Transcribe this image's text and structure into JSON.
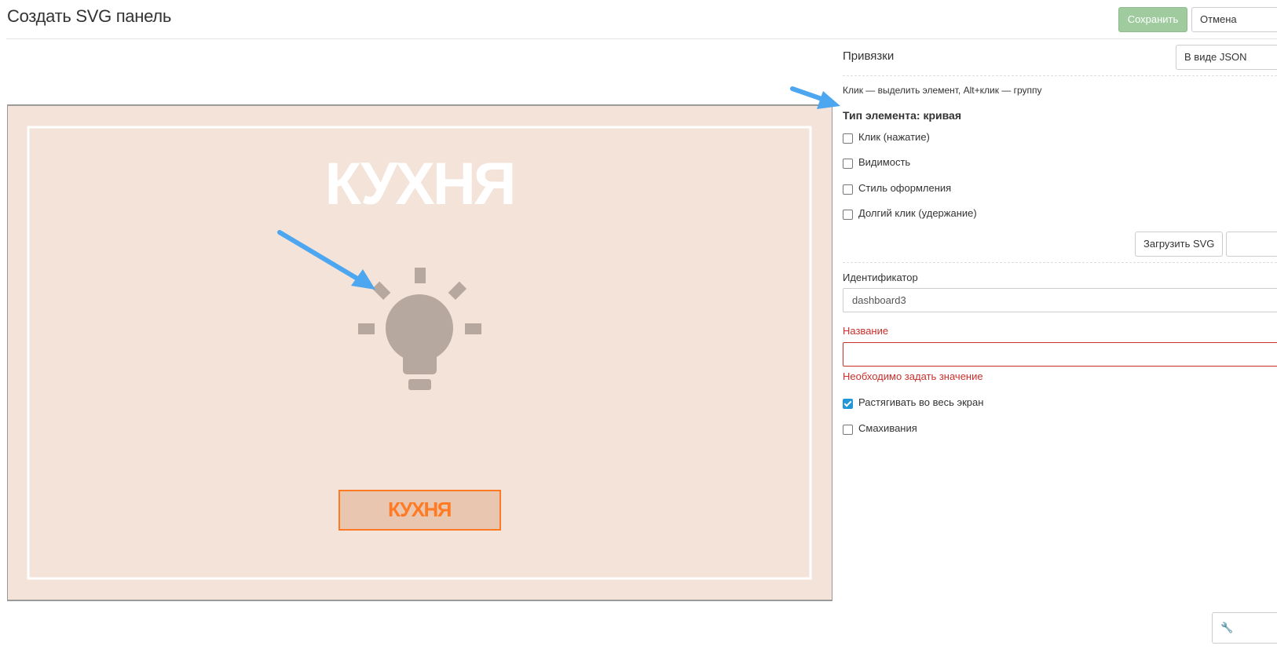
{
  "header": {
    "title": "Создать SVG панель",
    "save_label": "Сохранить",
    "cancel_label": "Отмена"
  },
  "canvas": {
    "title_text": "КУХНЯ",
    "button_text": "КУХНЯ",
    "icon": "lightbulb-icon",
    "colors": {
      "background": "#f3e3d8",
      "frame": "#ffffff",
      "icon": "#b7a89f",
      "button_fill": "#e8c6b0",
      "button_border": "#ff7a22",
      "button_text": "#ff7a22"
    }
  },
  "bindings_panel": {
    "title": "Привязки",
    "json_button_label": "В виде JSON",
    "hint": "Клик — выделить элемент, Alt+клик — группу",
    "element_type": "Тип элемента: кривая",
    "options": [
      {
        "label": "Клик (нажатие)",
        "checked": false
      },
      {
        "label": "Видимость",
        "checked": false
      },
      {
        "label": "Стиль оформления",
        "checked": false
      },
      {
        "label": "Долгий клик (удержание)",
        "checked": false
      }
    ],
    "load_svg_label": "Загрузить SVG",
    "extra_button_label": ""
  },
  "form": {
    "id_label": "Идентификатор",
    "id_value": "dashboard3",
    "name_label": "Название",
    "name_value": "",
    "name_error": "Необходимо задать значение",
    "stretch_label": "Растягивать во весь экран",
    "stretch_checked": true,
    "swipe_label": "Смахивания",
    "swipe_checked": false
  },
  "annotations": {
    "arrow_color": "#4da6f0"
  }
}
